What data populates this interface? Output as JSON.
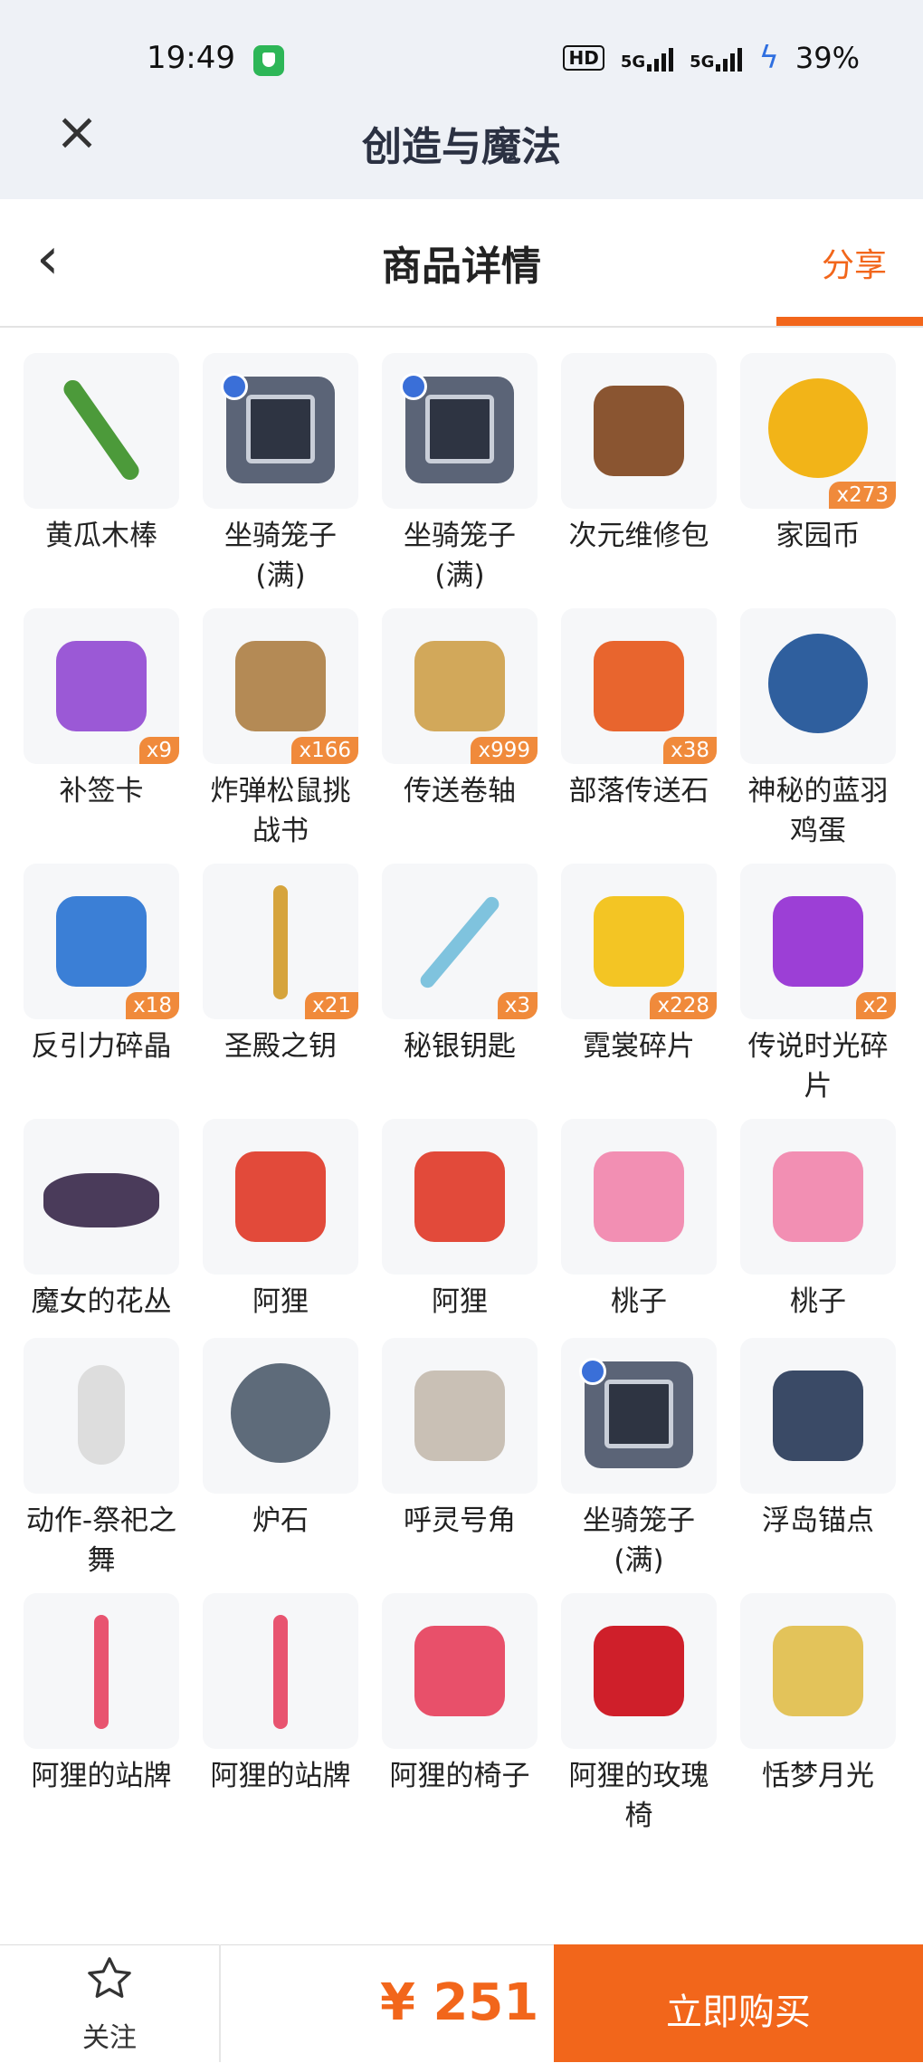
{
  "status": {
    "time": "19:49",
    "hd": "HD",
    "net1": "5G",
    "net2": "5G",
    "battery": "39%"
  },
  "app": {
    "title": "创造与魔法",
    "close_icon": "close-icon"
  },
  "nav": {
    "title": "商品详情",
    "share": "分享",
    "back_icon": "chevron-left-icon"
  },
  "colors": {
    "accent": "#f2661b",
    "badge": "#f08a3b"
  },
  "items": [
    {
      "name": "黄瓜木棒",
      "qty": "",
      "icon": "cucumber-stick-icon"
    },
    {
      "name": "坐骑笼子(满)",
      "qty": "",
      "icon": "mount-cage-icon"
    },
    {
      "name": "坐骑笼子(满)",
      "qty": "",
      "icon": "mount-cage-icon"
    },
    {
      "name": "次元维修包",
      "qty": "",
      "icon": "repair-bag-icon"
    },
    {
      "name": "家园币",
      "qty": "x273",
      "icon": "gold-coin-icon"
    },
    {
      "name": "补签卡",
      "qty": "x9",
      "icon": "ticket-icon"
    },
    {
      "name": "炸弹松鼠挑战书",
      "qty": "x166",
      "icon": "wanted-scroll-icon"
    },
    {
      "name": "传送卷轴",
      "qty": "x999",
      "icon": "scroll-icon"
    },
    {
      "name": "部落传送石",
      "qty": "x38",
      "icon": "teleport-stone-icon"
    },
    {
      "name": "神秘的蓝羽鸡蛋",
      "qty": "",
      "icon": "blue-egg-icon"
    },
    {
      "name": "反引力碎晶",
      "qty": "x18",
      "icon": "crystal-icon"
    },
    {
      "name": "圣殿之钥",
      "qty": "x21",
      "icon": "gold-key-icon"
    },
    {
      "name": "秘银钥匙",
      "qty": "x3",
      "icon": "silver-key-icon"
    },
    {
      "name": "霓裳碎片",
      "qty": "x228",
      "icon": "shirt-icon"
    },
    {
      "name": "传说时光碎片",
      "qty": "x2",
      "icon": "puzzle-piece-icon"
    },
    {
      "name": "魔女的花丛",
      "qty": "",
      "icon": "flower-bush-icon"
    },
    {
      "name": "阿狸",
      "qty": "",
      "icon": "ali-lion-icon"
    },
    {
      "name": "阿狸",
      "qty": "",
      "icon": "ali-lion-icon"
    },
    {
      "name": "桃子",
      "qty": "",
      "icon": "bunny-icon"
    },
    {
      "name": "桃子",
      "qty": "",
      "icon": "bunny-icon"
    },
    {
      "name": "动作-祭祀之舞",
      "qty": "",
      "icon": "dance-pose-icon"
    },
    {
      "name": "炉石",
      "qty": "",
      "icon": "hearthstone-icon"
    },
    {
      "name": "呼灵号角",
      "qty": "",
      "icon": "horn-icon"
    },
    {
      "name": "坐骑笼子(满)",
      "qty": "",
      "icon": "mount-cage-icon"
    },
    {
      "name": "浮岛锚点",
      "qty": "",
      "icon": "anchor-icon"
    },
    {
      "name": "阿狸的站牌",
      "qty": "",
      "icon": "sign-icon"
    },
    {
      "name": "阿狸的站牌",
      "qty": "",
      "icon": "sign-icon"
    },
    {
      "name": "阿狸的椅子",
      "qty": "",
      "icon": "bench-icon"
    },
    {
      "name": "阿狸的玫瑰椅",
      "qty": "",
      "icon": "rose-icon"
    },
    {
      "name": "恬梦月光",
      "qty": "",
      "icon": "moon-bed-icon"
    }
  ],
  "bottom": {
    "follow": "关注",
    "price": "¥ 251",
    "buy": "立即购买",
    "star_icon": "star-icon"
  }
}
